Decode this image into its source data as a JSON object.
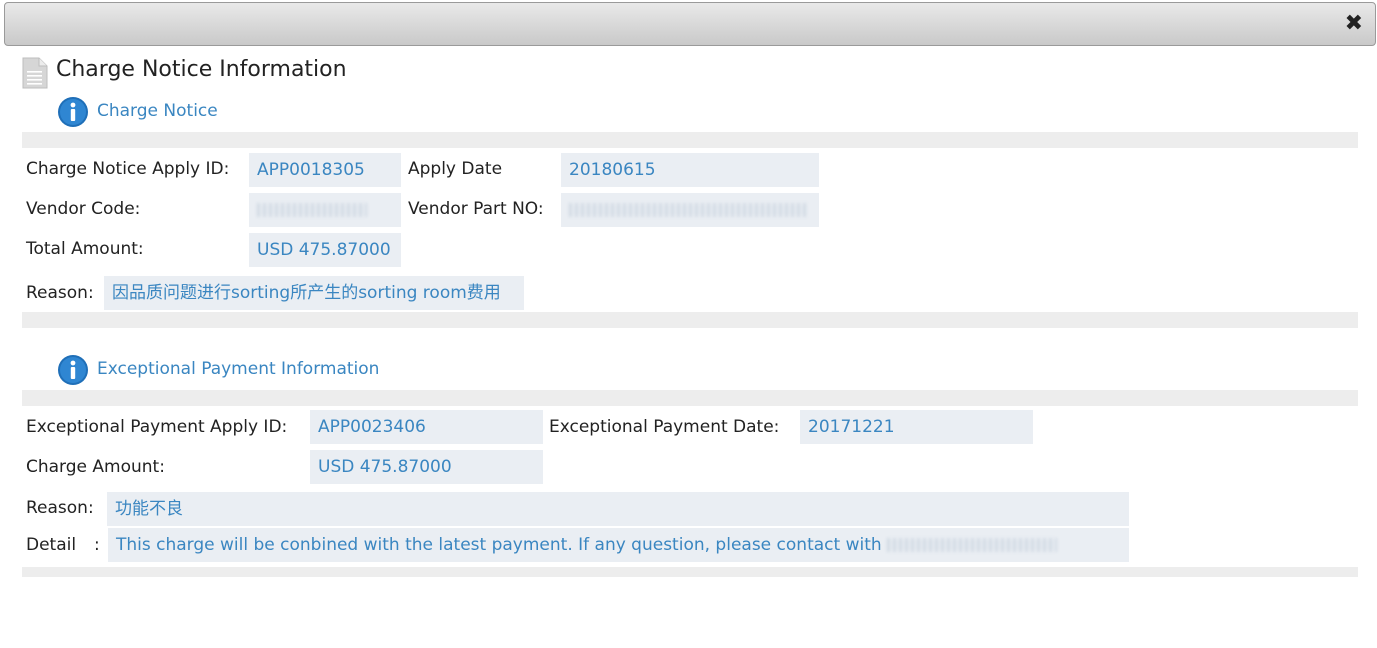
{
  "window": {
    "close_glyph": "✖"
  },
  "page": {
    "title": "Charge Notice Information",
    "icon": "document-icon"
  },
  "charge_notice": {
    "title": "Charge Notice",
    "icon": "info-icon",
    "apply_id_label": "Charge Notice Apply ID:",
    "apply_id": "APP0018305",
    "apply_date_label": "Apply Date",
    "apply_date": "20180615",
    "vendor_code_label": "Vendor Code:",
    "vendor_part_label": "Vendor Part NO:",
    "total_amount_label": "Total Amount:",
    "total_amount": "USD 475.87000",
    "reason_label": "Reason:",
    "reason": "因品质问题进行sorting所产生的sorting room费用"
  },
  "exceptional_payment": {
    "title": "Exceptional Payment Information",
    "icon": "info-icon",
    "apply_id_label": "Exceptional Payment Apply ID:",
    "apply_id": "APP0023406",
    "date_label": "Exceptional Payment Date:",
    "date": "20171221",
    "charge_amount_label": "Charge Amount:",
    "charge_amount": "USD 475.87000",
    "reason_label": "Reason:",
    "reason": "功能不良",
    "detail_label": "Detail",
    "detail_sep": ":",
    "detail": "This charge will be conbined with the latest payment. If any question, please contact with"
  }
}
